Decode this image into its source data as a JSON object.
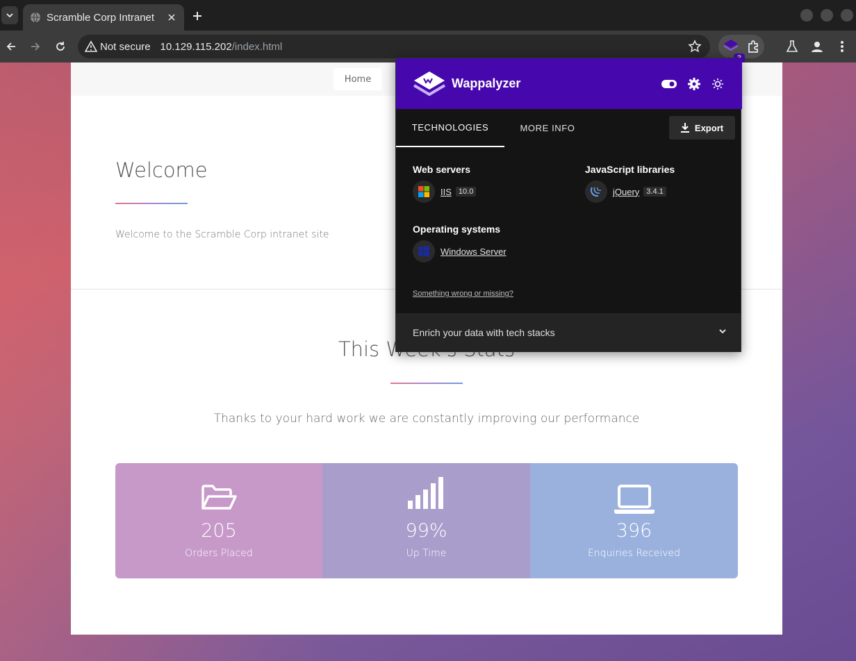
{
  "browser": {
    "tab_title": "Scramble Corp Intranet",
    "security_label": "Not secure",
    "url_host": "10.129.115.202",
    "url_path": "/index.html",
    "extension_badge": "3"
  },
  "page": {
    "nav": {
      "home": "Home"
    },
    "welcome": {
      "title": "Welcome",
      "text": "Welcome to the Scramble Corp intranet site"
    },
    "stats": {
      "title": "This Week's Stats",
      "subtitle": "Thanks to your hard work we are constantly improving our performance",
      "items": [
        {
          "value": "205",
          "label": "Orders Placed",
          "icon": "folder-open-icon",
          "color": "#c699c8"
        },
        {
          "value": "99%",
          "label": "Up Time",
          "icon": "signal-bars-icon",
          "color": "#a99dcb"
        },
        {
          "value": "396",
          "label": "Enquiries Received",
          "icon": "laptop-icon",
          "color": "#9ab1de"
        }
      ]
    }
  },
  "wappalyzer": {
    "title": "Wappalyzer",
    "brand_color": "#4608ad",
    "tabs": {
      "technologies": "TECHNOLOGIES",
      "more_info": "MORE INFO"
    },
    "export_label": "Export",
    "categories": {
      "web_servers": {
        "title": "Web servers",
        "items": [
          {
            "name": "IIS",
            "version": "10.0",
            "icon": "iis-icon"
          }
        ]
      },
      "js_libraries": {
        "title": "JavaScript libraries",
        "items": [
          {
            "name": "jQuery",
            "version": "3.4.1",
            "icon": "jquery-icon"
          }
        ]
      },
      "operating_systems": {
        "title": "Operating systems",
        "items": [
          {
            "name": "Windows Server",
            "icon": "windows-icon"
          }
        ]
      }
    },
    "wrong_link": "Something wrong or missing?",
    "enrich_label": "Enrich your data with tech stacks"
  }
}
